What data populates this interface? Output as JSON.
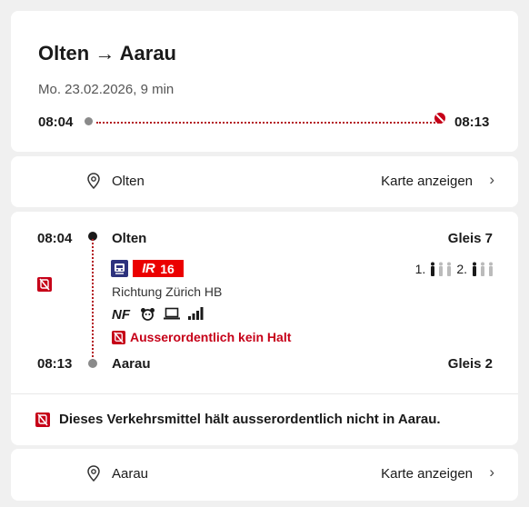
{
  "journey": {
    "title": "Olten → Aarau",
    "subtitle": "Mo. 23.02.2026, 9 min",
    "dep_time": "08:04",
    "arr_time": "08:13"
  },
  "origin_row": {
    "location": "Olten",
    "map_link": "Karte anzeigen",
    "chevron": "›"
  },
  "leg": {
    "dep_time": "08:04",
    "dep_station": "Olten",
    "dep_platform": "Gleis 7",
    "product": "IR",
    "line": "16",
    "direction": "Richtung Zürich HB",
    "attributes": [
      "NF"
    ],
    "service_icons": [
      "family-zone-icon",
      "laptop-icon",
      "signal-icon"
    ],
    "alert": "Ausserordentlich kein Halt",
    "arr_time": "08:13",
    "arr_station": "Aarau",
    "arr_platform": "Gleis 2",
    "occupancy": [
      {
        "class_label": "1."
      },
      {
        "class_label": "2."
      }
    ]
  },
  "notice": {
    "text": "Dieses Verkehrsmittel hält ausserordentlich nicht in Aarau."
  },
  "destination_row": {
    "location": "Aarau",
    "map_link": "Karte anzeigen",
    "chevron": "›"
  },
  "colors": {
    "accent": "#eb0000",
    "alert": "#c60018",
    "text": "#1a1a1a"
  }
}
